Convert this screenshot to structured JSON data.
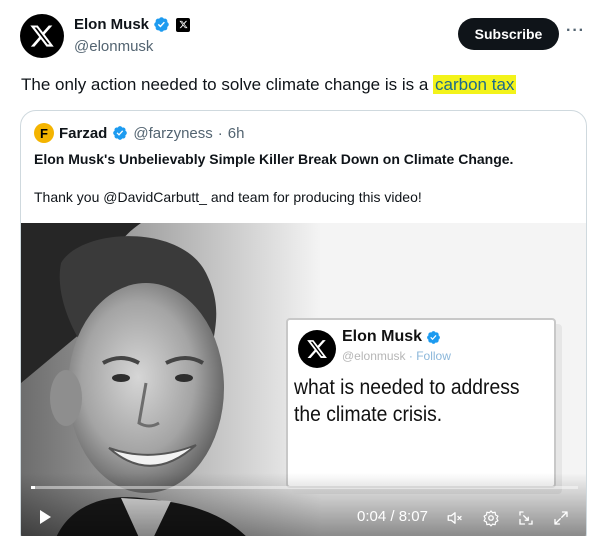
{
  "author": {
    "name": "Elon Musk",
    "handle": "@elonmusk",
    "icons": [
      "x-logo-avatar",
      "verified-badge-icon",
      "x-affiliate-badge-icon"
    ]
  },
  "header": {
    "subscribe_label": "Subscribe",
    "more_label": "···"
  },
  "tweet": {
    "text_before": "The only action needed to solve climate change is is a ",
    "highlighted_text": "carbon tax",
    "highlight_color": "#f3f31a"
  },
  "quote": {
    "avatar_letter": "F",
    "name": "Farzad",
    "handle": "@farzyness",
    "separator": "·",
    "age": "6h",
    "title": "Elon Musk's Unbelievably Simple Killer Break Down on Climate Change.",
    "body": "Thank you @DavidCarbutt_ and team for producing this video!"
  },
  "video": {
    "embedded_card": {
      "name": "Elon Musk",
      "handle": "@elonmusk",
      "follow_label": "· Follow",
      "line1": "what is needed to address",
      "line2": "the climate crisis."
    },
    "current_time": "0:04",
    "duration": "8:07",
    "time_separator": " / ",
    "progress_fraction": 0.008,
    "controls": [
      "play-icon",
      "mute-icon",
      "settings-icon",
      "pip-icon",
      "fullscreen-icon"
    ]
  },
  "colors": {
    "verified": "#1d9bf0",
    "text": "#0f1419",
    "secondary": "#536471",
    "quote_avatar": "#f4b400"
  }
}
